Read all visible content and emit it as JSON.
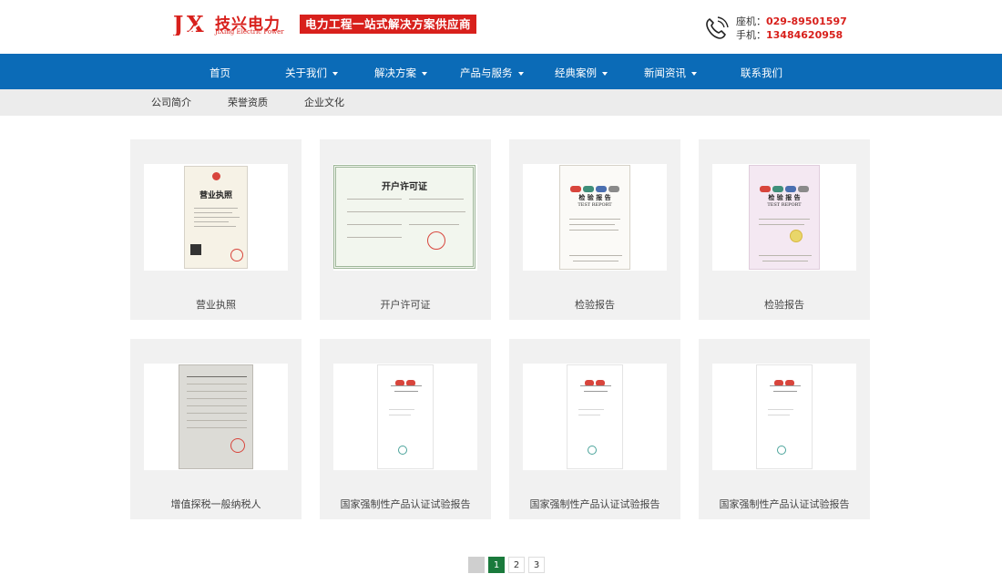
{
  "header": {
    "logo_cn": "技兴电力",
    "logo_en": "JiXing Electric Power",
    "slogan": "电力工程一站式解决方案供应商",
    "landline_label": "座机：",
    "landline": "029-89501597",
    "mobile_label": "手机：",
    "mobile": "13484620958"
  },
  "nav": {
    "items": [
      {
        "label": "首页",
        "dropdown": false
      },
      {
        "label": "关于我们",
        "dropdown": true
      },
      {
        "label": "解决方案",
        "dropdown": true
      },
      {
        "label": "产品与服务",
        "dropdown": true
      },
      {
        "label": "经典案例",
        "dropdown": true
      },
      {
        "label": "新闻资讯",
        "dropdown": true
      },
      {
        "label": "联系我们",
        "dropdown": false
      }
    ]
  },
  "subnav": {
    "items": [
      {
        "label": "公司简介"
      },
      {
        "label": "荣誉资质"
      },
      {
        "label": "企业文化"
      }
    ]
  },
  "gallery": {
    "items": [
      {
        "caption": "营业执照",
        "doc_title": "营业执照",
        "kind": "license"
      },
      {
        "caption": "开户许可证",
        "doc_title": "开户许可证",
        "kind": "permit"
      },
      {
        "caption": "检验报告",
        "doc_title": "检 验 报 告",
        "doc_sub": "TEST REPORT",
        "kind": "report"
      },
      {
        "caption": "检验报告",
        "doc_title": "检 验 报 告",
        "doc_sub": "TEST REPORT",
        "kind": "report-pink"
      },
      {
        "caption": "增值探税一般纳税人",
        "kind": "tax"
      },
      {
        "caption": "国家强制性产品认证试验报告",
        "kind": "ccc"
      },
      {
        "caption": "国家强制性产品认证试验报告",
        "kind": "ccc"
      },
      {
        "caption": "国家强制性产品认证试验报告",
        "kind": "ccc"
      }
    ]
  },
  "pagination": {
    "pages": [
      "1",
      "2",
      "3"
    ],
    "current": "1"
  },
  "colors": {
    "brand_red": "#d8201c",
    "nav_blue": "#0b6bb7",
    "active_page": "#1a7a3c"
  }
}
